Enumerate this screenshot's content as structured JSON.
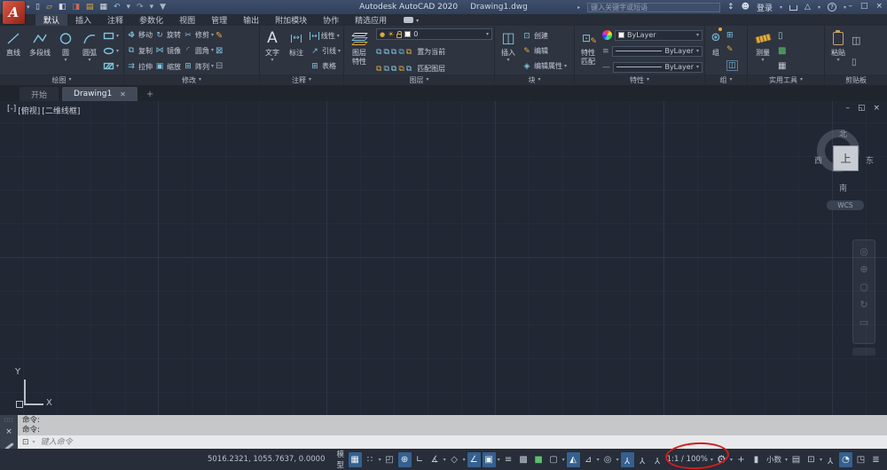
{
  "titlebar": {
    "app_title": "Autodesk AutoCAD 2020",
    "doc_title": "Drawing1.dwg",
    "search_placeholder": "键入关键字或短语",
    "signin_label": "登录"
  },
  "ribbon_tabs": {
    "tabs": [
      "默认",
      "插入",
      "注释",
      "参数化",
      "视图",
      "管理",
      "输出",
      "附加模块",
      "协作",
      "精选应用"
    ],
    "active": "默认"
  },
  "panels": {
    "draw": {
      "label": "绘图",
      "buttons": [
        "直线",
        "多段线",
        "圆",
        "圆弧"
      ]
    },
    "modify": {
      "label": "修改",
      "cols": [
        [
          "移动",
          "复制",
          "拉伸"
        ],
        [
          "旋转",
          "镜像",
          "缩放"
        ],
        [
          "修剪",
          "圆角",
          "阵列"
        ]
      ]
    },
    "annotate": {
      "label": "注释",
      "text": "文字",
      "dim": "标注",
      "list": [
        "线性",
        "引线",
        "表格"
      ]
    },
    "layers": {
      "label": "图层",
      "big_line1": "图层",
      "big_line2": "特性",
      "combo_value": "0",
      "action1": "置为当前",
      "action2": "匹配图层"
    },
    "block": {
      "label": "块",
      "big": "插入",
      "list": [
        "创建",
        "编辑",
        "编辑属性"
      ]
    },
    "properties": {
      "label": "特性",
      "big_line1": "特性",
      "big_line2": "匹配",
      "color_value": "ByLayer",
      "lineweight_value": "ByLayer",
      "linetype_value": "ByLayer"
    },
    "group": {
      "label": "组",
      "big": "组"
    },
    "utilities": {
      "label": "实用工具",
      "big": "测量"
    },
    "clipboard": {
      "label": "剪贴板",
      "big": "粘贴"
    }
  },
  "file_tabs": {
    "start": "开始",
    "drawing": "Drawing1"
  },
  "viewport": {
    "label_min": "[-]",
    "label_view": "[俯视]",
    "label_style": "[二维线框]",
    "viewcube": {
      "north": "北",
      "south": "南",
      "west": "西",
      "east": "东",
      "top": "上",
      "wcs": "WCS"
    },
    "axis_x": "X",
    "axis_y": "Y"
  },
  "command": {
    "line1": "命令:",
    "line2": "命令:",
    "placeholder": "键入命令"
  },
  "statusbar": {
    "coords": "5016.2321, 1055.7637, 0.0000",
    "model_label": "模型",
    "scale_label": "1:1 / 100%",
    "units_label": "小数"
  },
  "colors": {
    "status_highlight": "#35608f",
    "accent_teal": "#7fc4e0",
    "accent_yellow": "#e0a93f",
    "annotation_red": "#cf1d1d",
    "titlebar": "#31405a",
    "canvas": "#222734"
  },
  "icons": {
    "caret": "▾",
    "menu_caret": "▼",
    "undo": "↶",
    "redo": "↷",
    "search_expand": "▸",
    "person": "☻",
    "alert": "△",
    "help": "?",
    "minimize": "–",
    "maximize": "□",
    "close": "×",
    "new_doc": "▯",
    "open_doc": "▱",
    "save_doc": "◧",
    "saveas_doc": "◨",
    "plot_doc": "▤",
    "print_doc": "▦",
    "move_h": "↔",
    "move_v": "↕",
    "rotate": "↻",
    "trim": "✂",
    "copy": "⧉",
    "mirror": "⋈",
    "fillet": "◜",
    "stretch": "⇉",
    "scale": "▣",
    "array": "⊞",
    "pencil": "✎",
    "explode": "⊠",
    "join": "⊟",
    "text": "A",
    "leader": "↗",
    "table": "⊞",
    "linear": "↔",
    "dim": "↔",
    "insert": "◫",
    "create": "⊡",
    "edit": "✎",
    "edit_attr": "◈",
    "bulb": "●",
    "sun": "☀",
    "chip": "⧉",
    "lw": "≡",
    "lt": "—",
    "group": "⊛",
    "group_a": "⊞",
    "group_b": "✎",
    "group_c": "◫",
    "util_a": "▯",
    "util_b": "▩",
    "util_c": "▦",
    "clip_a": "◫",
    "clip_b": "▯",
    "grid": "▦",
    "snap": "∷",
    "infer": "◰",
    "dyninput": "⊕",
    "ortho": "∟",
    "polar": "∡",
    "iso": "◇",
    "otrack": "∠",
    "osnap": "▣",
    "lineweight": "≡",
    "transparency": "▩",
    "cycling": "■",
    "quickprops": "▢",
    "threeosnap": "◭",
    "dynucs": "⊿",
    "gizmo": "◎",
    "annot": "Y",
    "gear": "⚙",
    "plus": "+",
    "isolate": "▮",
    "annot_list": "▤",
    "monitor": "⊡",
    "clock": "◔",
    "clean": "◳",
    "burger": "≣",
    "tab_close": "✕",
    "tab_add": "+",
    "cmd_icon": "⊡",
    "nav_a": "◎",
    "nav_b": "⊕",
    "nav_c": "○",
    "nav_d": "↻",
    "nav_e": "▭",
    "vp_min": "–",
    "vp_restore": "◱",
    "vp_close": "×",
    "grip": "∷∷"
  }
}
